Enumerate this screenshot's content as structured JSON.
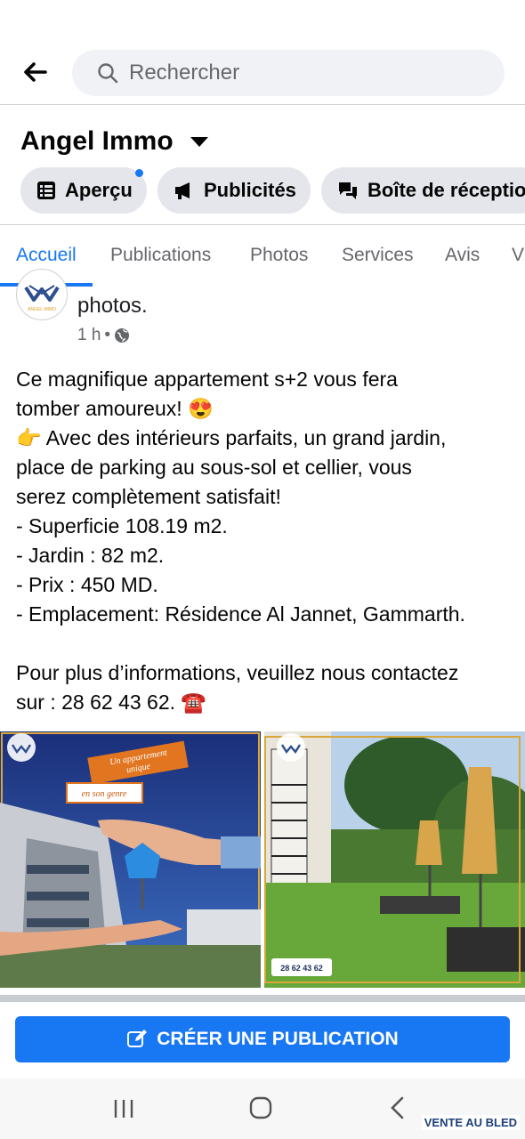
{
  "search": {
    "placeholder": "Rechercher"
  },
  "page": {
    "name": "Angel Immo"
  },
  "chips": [
    {
      "label": "Aperçu",
      "icon": "list-icon",
      "has_badge": true
    },
    {
      "label": "Publicités",
      "icon": "megaphone-icon"
    },
    {
      "label": "Boîte de réceptio",
      "icon": "chat-bubbles-icon"
    }
  ],
  "tabs": [
    "Accueil",
    "Publications",
    "Photos",
    "Services",
    "Avis",
    "V"
  ],
  "active_tab": "Accueil",
  "post": {
    "author_logo_text": "ANGEL IMMO",
    "header_text": "photos.",
    "time": "1 h",
    "audience_icon": "globe-icon",
    "lines": [
      "Ce magnifique appartement s+2 vous fera",
      "tomber amoureux! 😍",
      "👉 Avec des intérieurs parfaits, un grand jardin,",
      "place de parking au sous-sol et cellier, vous",
      "serez complètement satisfait!",
      "- Superficie 108.19 m2.",
      "- Jardin : 82 m2.",
      "- Prix : 450 MD.",
      "- Emplacement: Résidence Al Jannet, Gammarth.",
      "",
      "Pour plus d’informations, veuillez nous contactez",
      "sur : 28 62 43 62. ☎️"
    ],
    "image1": {
      "banner_line1": "Un appartement",
      "banner_line2": "unique",
      "banner_line3": "en son genre"
    },
    "image2": {
      "phone": "28 62 43 62"
    }
  },
  "create_button": {
    "label": "CRÉER UNE PUBLICATION"
  },
  "watermark": "VENTE AU BLED",
  "colors": {
    "accent": "#1877f2",
    "chip_bg": "#e4e6eb",
    "search_bg": "#f0f2f5"
  }
}
